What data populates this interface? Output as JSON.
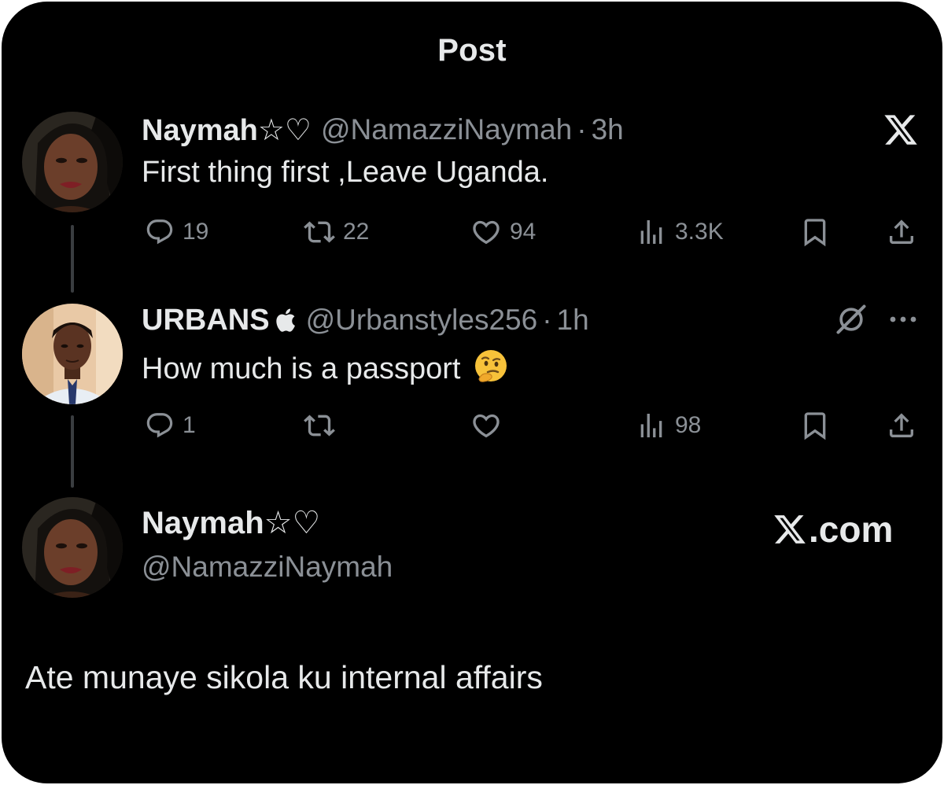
{
  "header": {
    "title": "Post"
  },
  "posts": [
    {
      "display_name": "Naymah☆♡",
      "handle": "@NamazziNaymah",
      "separator": "·",
      "time": "3h",
      "text": "First thing first ,Leave Uganda.",
      "stats": {
        "replies": "19",
        "reposts": "22",
        "likes": "94",
        "views": "3.3K"
      }
    },
    {
      "display_name": "URBANS",
      "handle": "@Urbanstyles256",
      "separator": "·",
      "time": "1h",
      "text": "How much is a passport",
      "text_emoji": "thinking-face",
      "stats": {
        "replies": "1",
        "reposts": "",
        "likes": "",
        "views": "98"
      }
    }
  ],
  "profile": {
    "display_name": "Naymah☆♡",
    "handle": "@NamazziNaymah"
  },
  "watermark": {
    "text": ".com",
    "logo": "x-logo"
  },
  "caption": "Ate munaye sikola ku internal affairs",
  "icons": {
    "reply": "reply-icon",
    "repost": "repost-icon",
    "like": "heart-icon",
    "views": "views-icon",
    "bookmark": "bookmark-icon",
    "share": "share-icon",
    "grok": "grok-icon",
    "more": "more-icon",
    "apple": "apple-icon"
  },
  "colors": {
    "background": "#000000",
    "primary_text": "#e7e9ea",
    "secondary_text": "#8b9096",
    "thread_line": "#3a3d40"
  }
}
